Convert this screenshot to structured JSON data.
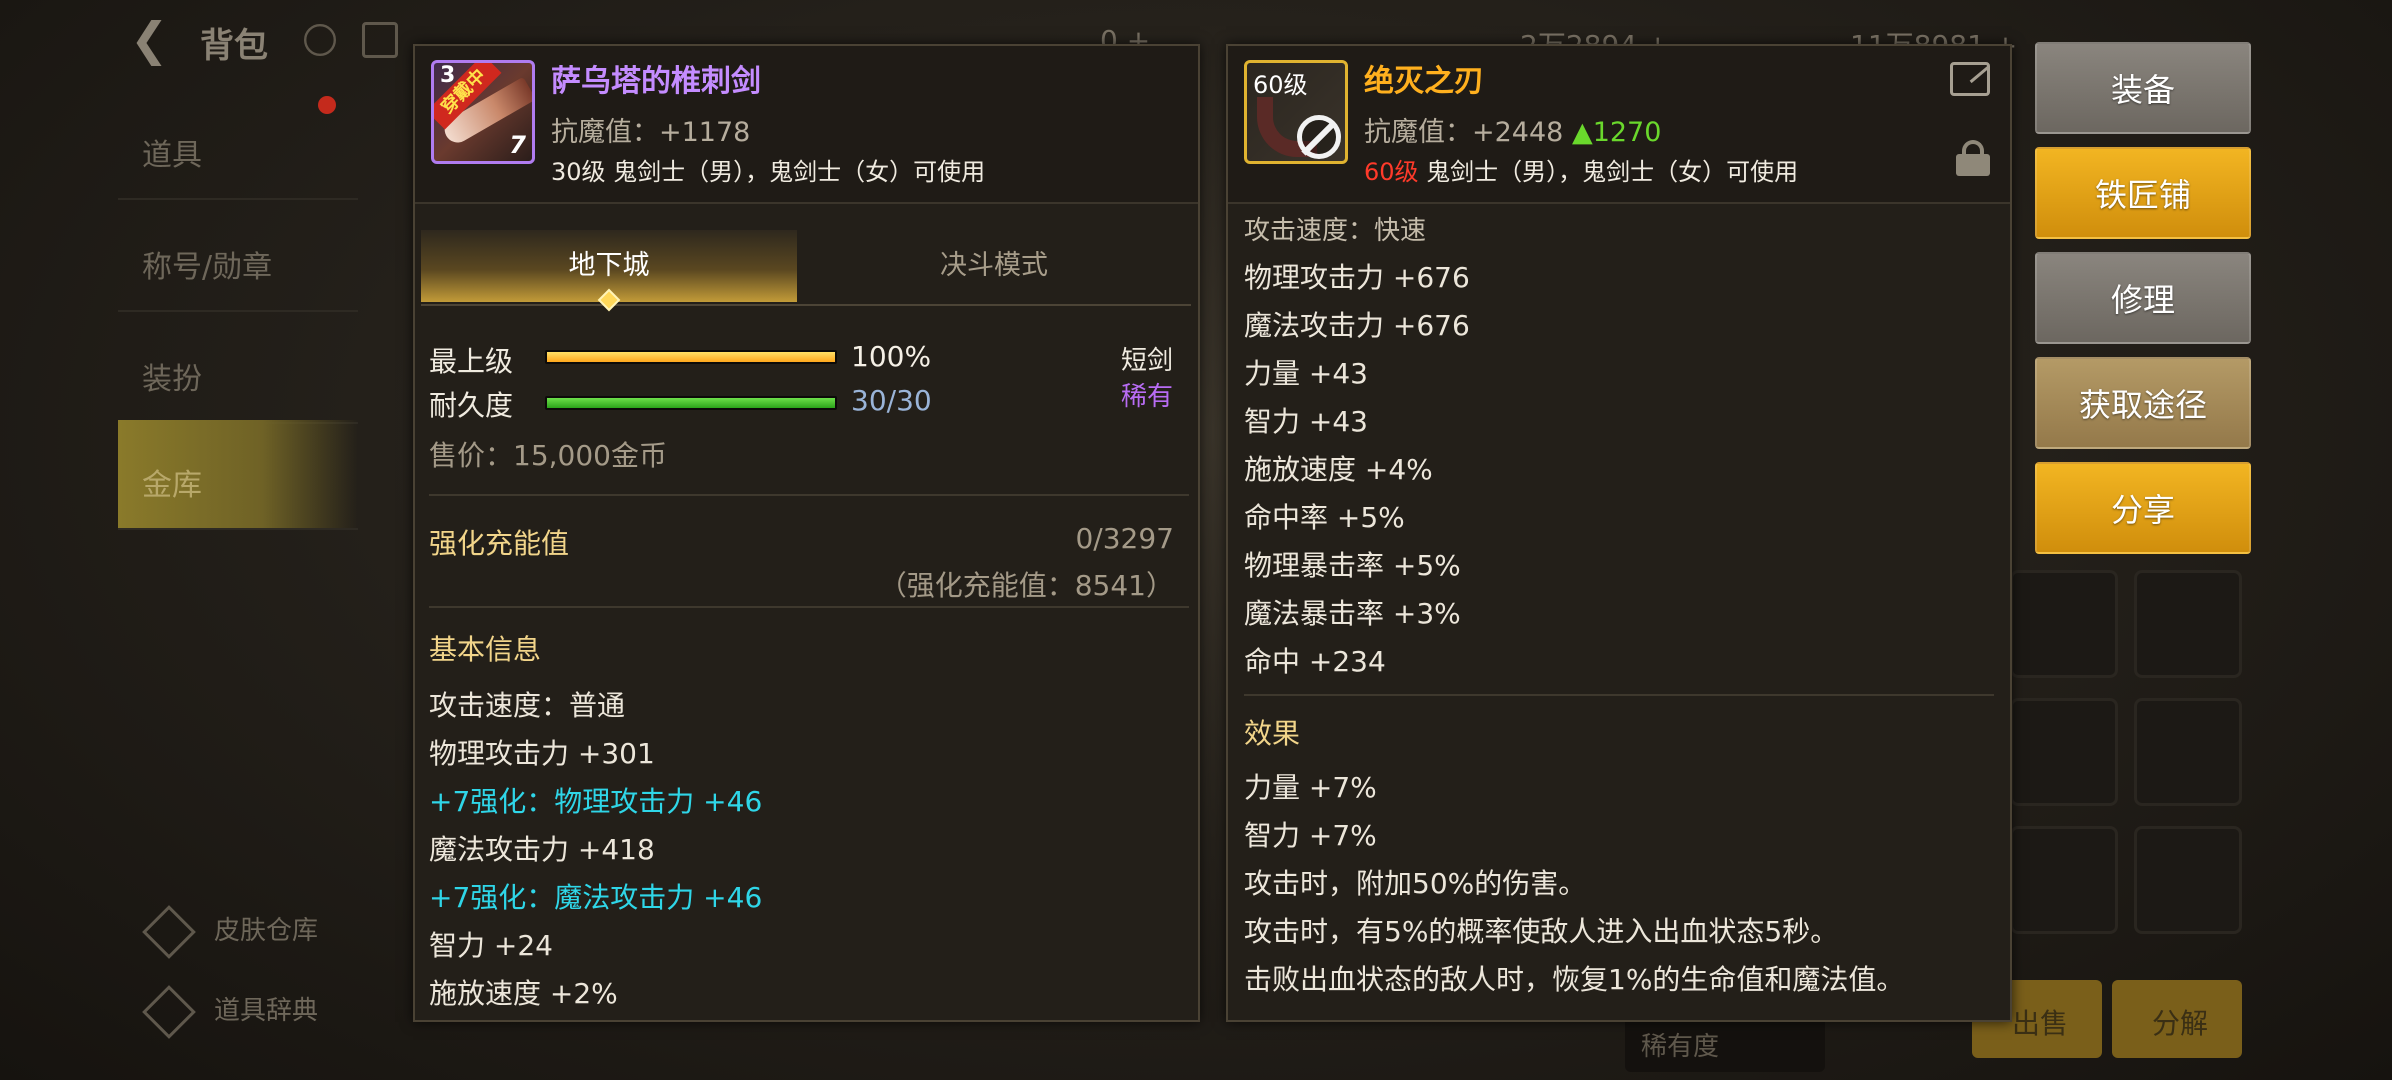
{
  "background": {
    "title": "背包",
    "currency1": "0 +",
    "currency2": "2万2894 +",
    "currency3": "11万8981 +",
    "sidebar_items": [
      {
        "label": "道具"
      },
      {
        "label": "称号/勋章"
      },
      {
        "label": "装扮"
      },
      {
        "label": "金库"
      }
    ],
    "skin_storage": "皮肤仓库",
    "item_dictionary": "道具辞典",
    "sell_label": "出售",
    "split_label": "分解",
    "rarity_filter": "稀有度"
  },
  "left_item": {
    "name": "萨乌塔的椎刺剑",
    "name_color": "#c48cff",
    "icon_badge": "穿戴中",
    "icon_top_number": "3",
    "icon_enhance_level": "7",
    "resist": "抗魔值：+1178",
    "requirement": "30级 鬼剑士（男），鬼剑士（女）可使用",
    "tabs": [
      {
        "label": "地下城"
      },
      {
        "label": "决斗模式"
      }
    ],
    "grade_label": "最上级",
    "grade_value": "100%",
    "grade_progress": 1.0,
    "durability_label": "耐久度",
    "durability_value": "30/30",
    "durability_progress": 1.0,
    "item_type": "短剑",
    "rarity": "稀有",
    "sale_price": "售价：15,000金币",
    "charge_title": "强化充能值",
    "charge_value": "0/3297",
    "charge_detail": "（强化充能值：8541）",
    "basic_info_title": "基本信息",
    "stats": [
      {
        "text": "攻击速度：普通",
        "kind": "normal"
      },
      {
        "text": "物理攻击力 +301",
        "kind": "normal"
      },
      {
        "text": "+7强化：物理攻击力 +46",
        "kind": "enhance"
      },
      {
        "text": "魔法攻击力 +418",
        "kind": "normal"
      },
      {
        "text": "+7强化：魔法攻击力 +46",
        "kind": "enhance"
      },
      {
        "text": "智力 +24",
        "kind": "normal"
      },
      {
        "text": "施放速度 +2%",
        "kind": "normal"
      }
    ]
  },
  "right_item": {
    "name": "绝灭之刃",
    "name_color": "#ffb01e",
    "icon_level": "60级",
    "resist_label": "抗魔值：+2448",
    "resist_diff": "▲1270",
    "req_level": "60级",
    "req_classes": " 鬼剑士（男），鬼剑士（女）可使用",
    "stats": [
      "攻击速度：快速",
      "物理攻击力 +676",
      "魔法攻击力 +676",
      "力量 +43",
      "智力 +43",
      "施放速度 +4%",
      "命中率 +5%",
      "物理暴击率 +5%",
      "魔法暴击率 +3%",
      "命中 +234"
    ],
    "effect_title": "效果",
    "effects": [
      "力量 +7%",
      "智力 +7%",
      "攻击时，附加50%的伤害。",
      "攻击时，有5%的概率使敌人进入出血状态5秒。",
      "击败出血状态的敌人时，恢复1%的生命值和魔法值。"
    ]
  },
  "action_buttons": [
    {
      "label": "装备",
      "style": "grey"
    },
    {
      "label": "铁匠铺",
      "style": "gold"
    },
    {
      "label": "修理",
      "style": "grey"
    },
    {
      "label": "获取途径",
      "style": "tan"
    },
    {
      "label": "分享",
      "style": "gold"
    }
  ],
  "colors": {
    "panel_bg": "#231f19",
    "gold_button": "#e4a415",
    "grey_button": "#7b766f",
    "tan_button": "#a78e5c",
    "enhance_cyan": "#2fd6e8",
    "heading_gold": "#f2d58a"
  }
}
